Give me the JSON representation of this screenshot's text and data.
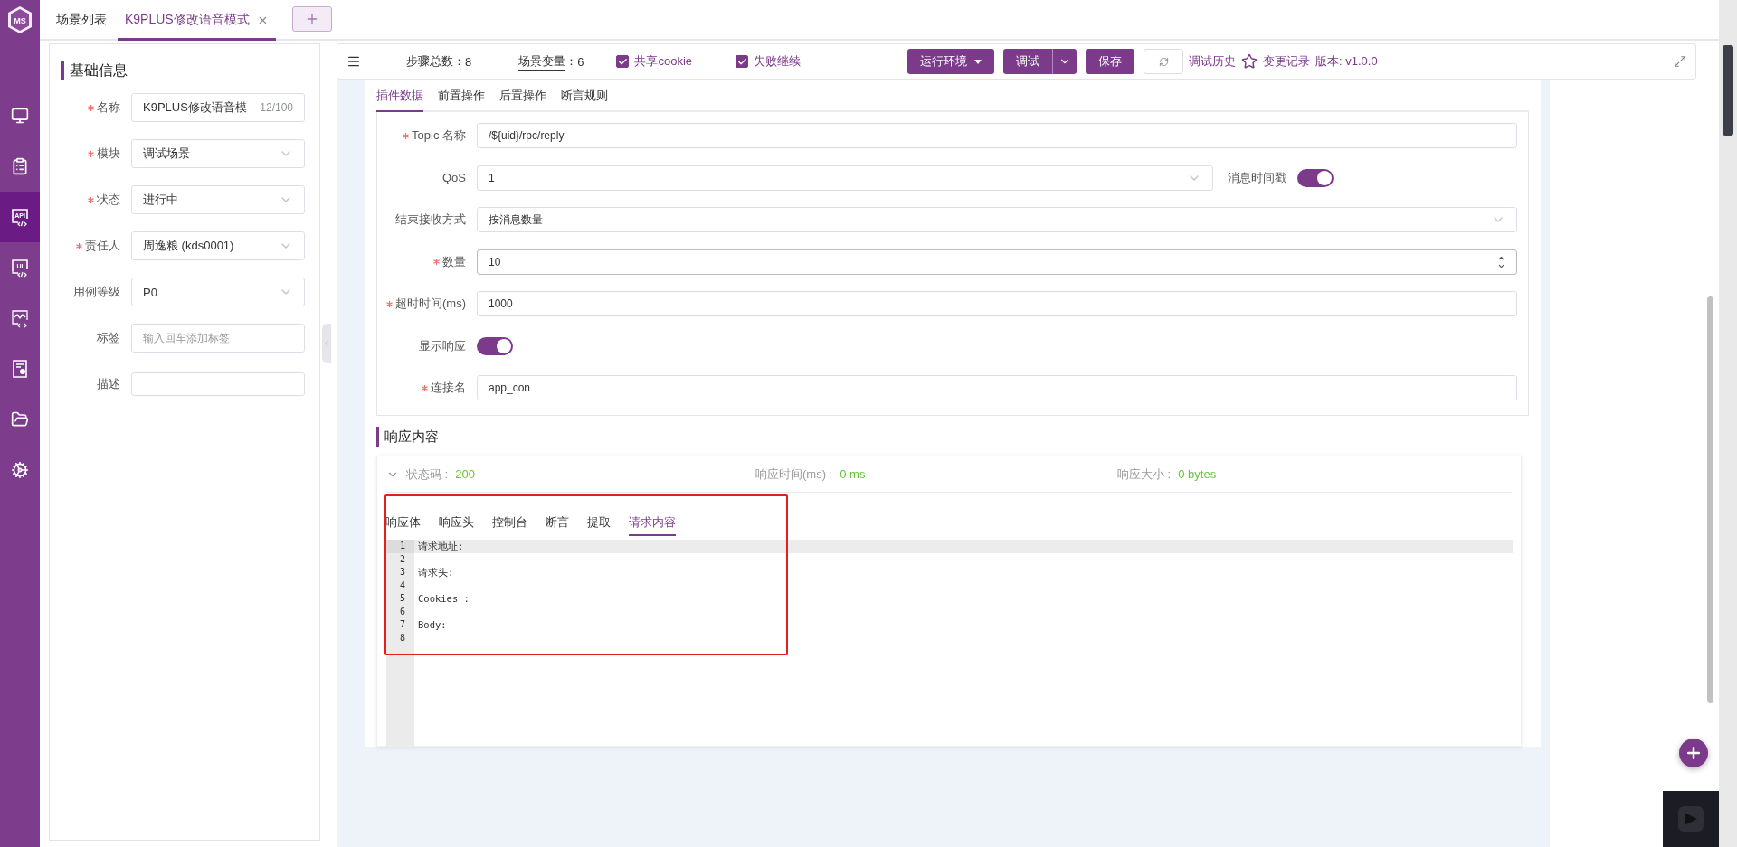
{
  "nav": {
    "logo": {
      "text": "MS"
    },
    "items": [
      {
        "kind": "monitor",
        "selected": false
      },
      {
        "kind": "clipboard",
        "selected": false
      },
      {
        "kind": "api",
        "label": "API",
        "selected": true
      },
      {
        "kind": "ui",
        "label": "UI",
        "selected": false
      },
      {
        "kind": "chart",
        "selected": false
      },
      {
        "kind": "report",
        "selected": false
      },
      {
        "kind": "folder",
        "selected": false
      },
      {
        "kind": "gears",
        "selected": false
      }
    ]
  },
  "tabs": [
    {
      "label": "场景列表",
      "selected": false,
      "closable": false
    },
    {
      "label": "K9PLUS修改语音模式",
      "selected": true,
      "closable": true
    }
  ],
  "basic_info": {
    "title": "基础信息",
    "fields": [
      {
        "kind": "input",
        "label": "名称",
        "required": true,
        "value": "K9PLUS修改语音模",
        "counter": "12/100"
      },
      {
        "kind": "select",
        "label": "模块",
        "required": true,
        "value": "调试场景"
      },
      {
        "kind": "select",
        "label": "状态",
        "required": true,
        "value": "进行中"
      },
      {
        "kind": "select",
        "label": "责任人",
        "required": true,
        "value": "周逸粮 (kds0001)"
      },
      {
        "kind": "select",
        "label": "用例等级",
        "required": false,
        "value": "P0"
      },
      {
        "kind": "input",
        "label": "标签",
        "required": false,
        "placeholder": "输入回车添加标签"
      },
      {
        "kind": "textarea",
        "label": "描述",
        "required": false
      }
    ]
  },
  "toolbar": {
    "steps_label": "步骤总数：",
    "steps": "8",
    "variables_label": "场景变量",
    "variables_sep": "：",
    "variables": "6",
    "checkboxes": [
      {
        "label": "共享cookie",
        "checked": true
      },
      {
        "label": "失败继续",
        "checked": true
      }
    ],
    "env_button": "运行环境",
    "debug_button": "调试",
    "save_button": "保存",
    "history_link": "调试历史",
    "changelog_link": "变更记录",
    "version": "版本: v1.0.0"
  },
  "plugin_tabs": [
    {
      "label": "插件数据",
      "selected": true
    },
    {
      "label": "前置操作",
      "selected": false
    },
    {
      "label": "后置操作",
      "selected": false
    },
    {
      "label": "断言规则",
      "selected": false
    }
  ],
  "plugin_form": [
    {
      "kind": "input",
      "label": "Topic 名称",
      "required": true,
      "value": "/${uid}/rpc/reply"
    },
    {
      "kind": "select",
      "label": "QoS",
      "required": false,
      "value": "1",
      "side_switch": {
        "label": "消息时间戳",
        "on": true
      }
    },
    {
      "kind": "select",
      "label": "结束接收方式",
      "required": false,
      "value": "按消息数量"
    },
    {
      "kind": "number",
      "label": "数量",
      "required": true,
      "value": "10"
    },
    {
      "kind": "input",
      "label": "超时时间(ms)",
      "required": true,
      "value": "1000"
    },
    {
      "kind": "switch",
      "label": "显示响应",
      "required": false,
      "on": true
    },
    {
      "kind": "input",
      "label": "连接名",
      "required": true,
      "value": "app_con"
    }
  ],
  "response": {
    "title": "响应内容",
    "expanded": true,
    "status": [
      {
        "label": "状态码 :",
        "value": "200"
      },
      {
        "label": "响应时间(ms) :",
        "value": "0 ms"
      },
      {
        "label": "响应大小 :",
        "value": "0 bytes"
      }
    ],
    "tabs": [
      {
        "label": "响应体",
        "selected": false
      },
      {
        "label": "响应头",
        "selected": false
      },
      {
        "label": "控制台",
        "selected": false
      },
      {
        "label": "断言",
        "selected": false
      },
      {
        "label": "提取",
        "selected": false
      },
      {
        "label": "请求内容",
        "selected": true
      }
    ],
    "lines": [
      {
        "number": "1",
        "text": "请求地址:",
        "active": true
      },
      {
        "number": "2",
        "active": false
      },
      {
        "number": "3",
        "text": "请求头:",
        "active": false
      },
      {
        "number": "4",
        "active": false
      },
      {
        "number": "5",
        "text": "Cookies :",
        "active": false
      },
      {
        "number": "6",
        "active": false
      },
      {
        "number": "7",
        "text": "Body:",
        "active": false
      },
      {
        "number": "8",
        "active": false
      }
    ]
  }
}
